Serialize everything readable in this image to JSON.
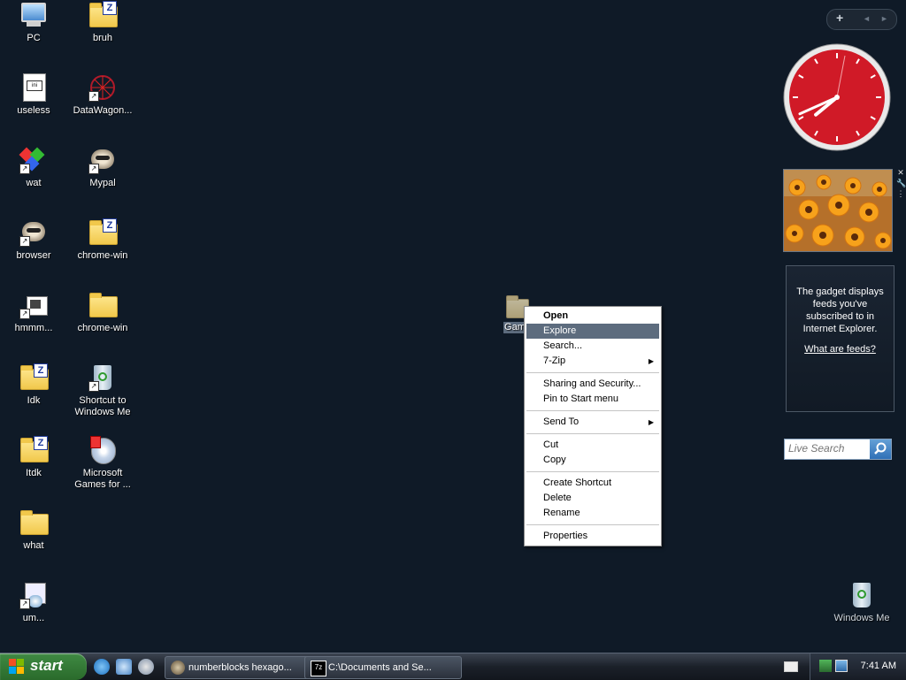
{
  "desktop_icons": [
    {
      "label": "PC",
      "icon": "computer-icon"
    },
    {
      "label": "bruh",
      "icon": "zip-folder-icon"
    },
    {
      "label": "useless",
      "icon": "ini-file-icon"
    },
    {
      "label": "DataWagon...",
      "icon": "datawagon-shortcut-icon"
    },
    {
      "label": "wat",
      "icon": "colorful-app-shortcut-icon"
    },
    {
      "label": "Mypal",
      "icon": "raccoon-shortcut-icon"
    },
    {
      "label": "browser",
      "icon": "raccoon-shortcut-icon"
    },
    {
      "label": "chrome-win",
      "icon": "zip-folder-icon"
    },
    {
      "label": "hmmm...",
      "icon": "network-app-shortcut-icon"
    },
    {
      "label": "chrome-win",
      "icon": "folder-icon"
    },
    {
      "label": "Idk",
      "icon": "zip-folder-icon"
    },
    {
      "label": "Shortcut to\nWindows Me",
      "icon": "recycle-bin-shortcut-icon"
    },
    {
      "label": "Itdk",
      "icon": "zip-folder-icon"
    },
    {
      "label": "Microsoft\nGames for ...",
      "icon": "games-cd-icon"
    },
    {
      "label": "what",
      "icon": "folder-icon"
    },
    {
      "label": "um...",
      "icon": "installer-shortcut-icon"
    },
    {
      "label": "Windows Me",
      "icon": "recycle-bin-icon"
    }
  ],
  "selected_icon": {
    "label": "Game",
    "icon": "folder-icon"
  },
  "context_menu": {
    "items": [
      {
        "label": "Open",
        "bold": true
      },
      {
        "label": "Explore",
        "selected": true
      },
      {
        "label": "Search..."
      },
      {
        "label": "7-Zip",
        "submenu": true
      },
      {
        "separator": true
      },
      {
        "label": "Sharing and Security..."
      },
      {
        "label": "Pin to Start menu"
      },
      {
        "separator": true
      },
      {
        "label": "Send To",
        "submenu": true
      },
      {
        "separator": true
      },
      {
        "label": "Cut"
      },
      {
        "label": "Copy"
      },
      {
        "separator": true
      },
      {
        "label": "Create Shortcut"
      },
      {
        "label": "Delete"
      },
      {
        "label": "Rename"
      },
      {
        "separator": true
      },
      {
        "label": "Properties"
      }
    ]
  },
  "sidebar": {
    "add_label": "+",
    "prev_label": "◄",
    "next_label": "►",
    "clock": {
      "hour": 7,
      "minute": 41,
      "face_color": "#d01a27"
    },
    "feeds": {
      "message": "The gadget displays feeds you've subscribed to in Internet Explorer.",
      "link": "What are feeds?"
    },
    "search": {
      "placeholder": "Live Search"
    }
  },
  "taskbar": {
    "start_label": "start",
    "tasks": [
      {
        "label": "numberblocks hexago...",
        "icon": "raccoon-icon"
      },
      {
        "label": "C:\\Documents and Se...",
        "icon": "7zip-icon"
      }
    ],
    "time": "7:41 AM"
  }
}
